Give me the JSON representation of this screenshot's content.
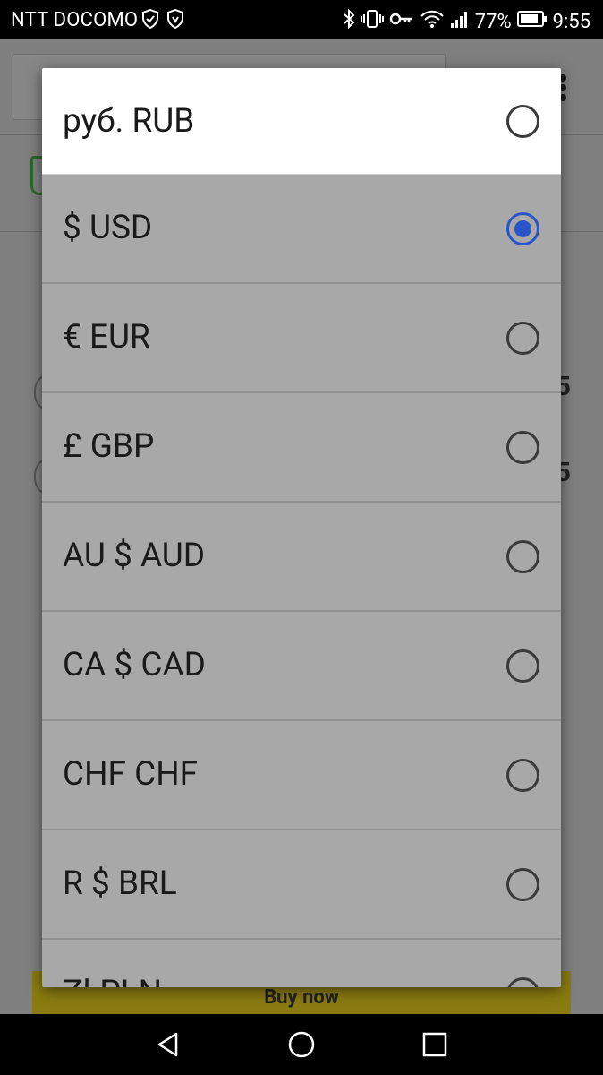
{
  "status_bar": {
    "carrier": "NTT DOCOMO",
    "battery_percent": "77%",
    "time": "9:55",
    "icons": [
      "shield-icon",
      "shield-check-icon",
      "bluetooth-icon",
      "vibrate-icon",
      "key-icon",
      "wifi-icon",
      "signal-icon",
      "battery-icon"
    ]
  },
  "background_app": {
    "buy_button_label": "Buy now",
    "partial_values": [
      "5",
      "5"
    ]
  },
  "currency_dialog": {
    "selected": "USD",
    "accent_color": "#2a55c8",
    "options": [
      {
        "label": "руб. RUB",
        "code": "RUB",
        "checked": false
      },
      {
        "label": "$ USD",
        "code": "USD",
        "checked": true
      },
      {
        "label": "€ EUR",
        "code": "EUR",
        "checked": false
      },
      {
        "label": "£ GBP",
        "code": "GBP",
        "checked": false
      },
      {
        "label": "AU $ AUD",
        "code": "AUD",
        "checked": false
      },
      {
        "label": "CA $ CAD",
        "code": "CAD",
        "checked": false
      },
      {
        "label": "CHF CHF",
        "code": "CHF",
        "checked": false
      },
      {
        "label": "R $ BRL",
        "code": "BRL",
        "checked": false
      },
      {
        "label": "Zł PLN",
        "code": "PLN",
        "checked": false
      }
    ]
  },
  "nav_bar": {
    "icons": [
      "back-icon",
      "home-icon",
      "recents-icon"
    ]
  }
}
